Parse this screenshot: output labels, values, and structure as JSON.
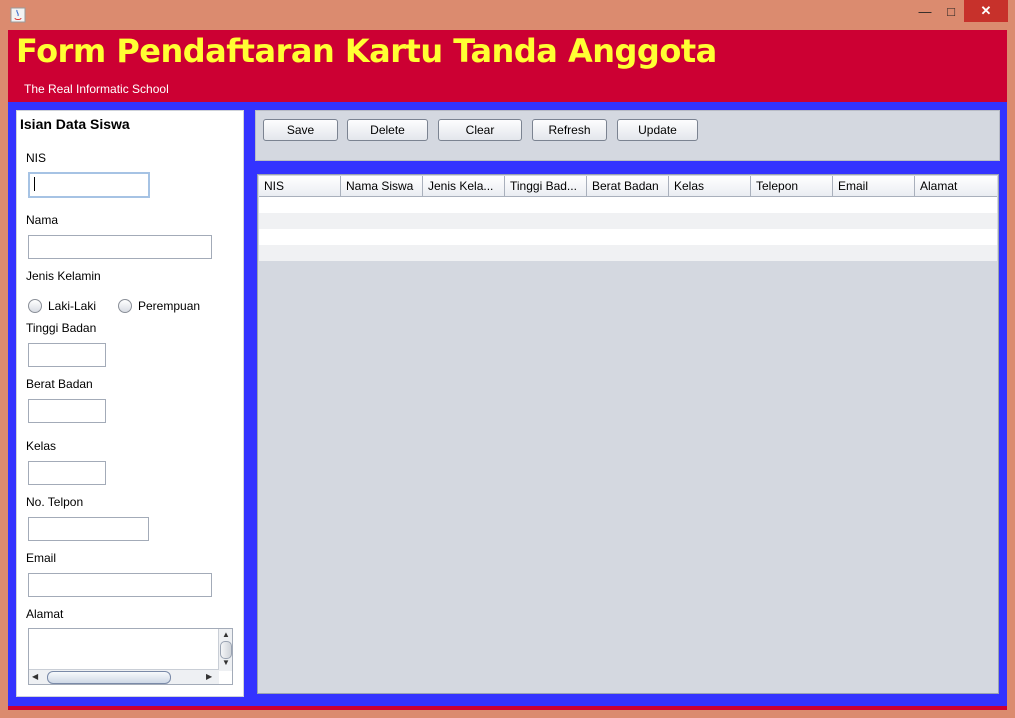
{
  "window": {
    "minimize": "—",
    "maximize": "□",
    "close": "✕"
  },
  "header": {
    "title": "Form Pendaftaran Kartu Tanda Anggota",
    "subtitle": "The Real Informatic School"
  },
  "form": {
    "title": "Isian Data Siswa",
    "nis_label": "NIS",
    "nama_label": "Nama",
    "jenis_kelamin_label": "Jenis Kelamin",
    "radio_laki": "Laki-Laki",
    "radio_perempuan": "Perempuan",
    "tinggi_label": "Tinggi Badan",
    "berat_label": "Berat Badan",
    "kelas_label": "Kelas",
    "telpon_label": "No. Telpon",
    "email_label": "Email",
    "alamat_label": "Alamat"
  },
  "toolbar": {
    "save": "Save",
    "delete": "Delete",
    "clear": "Clear",
    "refresh": "Refresh",
    "update": "Update"
  },
  "table": {
    "columns": [
      "NIS",
      "Nama Siswa",
      "Jenis Kela...",
      "Tinggi Bad...",
      "Berat Badan",
      "Kelas",
      "Telepon",
      "Email",
      "Alamat"
    ]
  },
  "colors": {
    "header_bg": "#cc0033",
    "title": "#ffff33",
    "panel_bg": "#3333ff"
  }
}
